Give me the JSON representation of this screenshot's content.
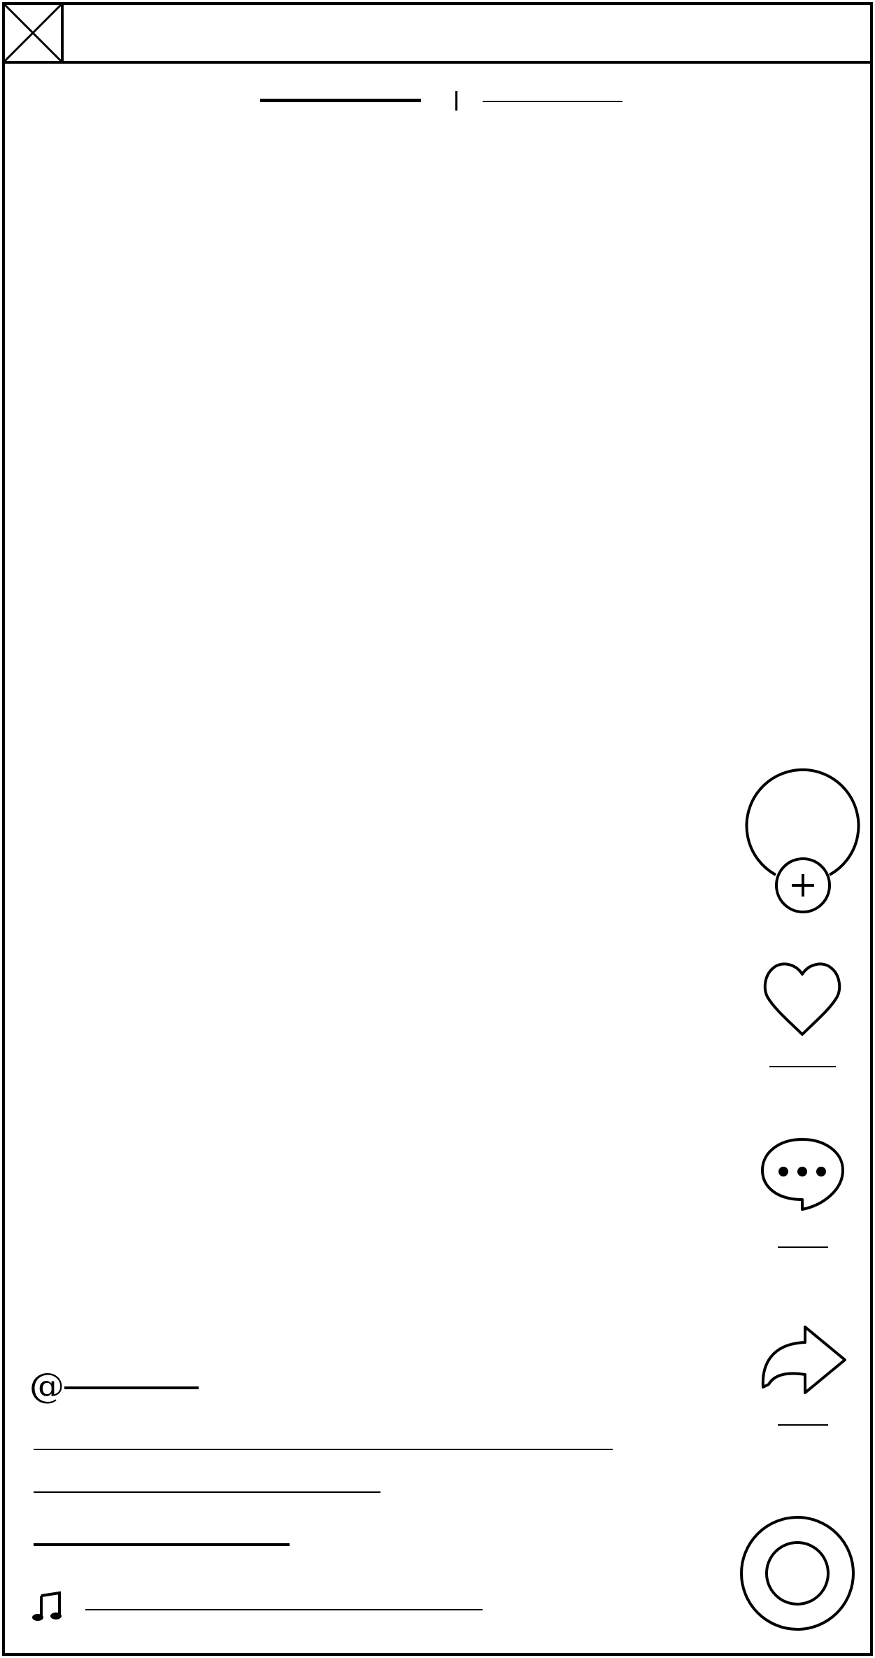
{
  "window": {
    "close_icon": "x-box-icon"
  },
  "top_tabs": {
    "tab_primary_label": "",
    "tab_secondary_label": "",
    "divider": "|"
  },
  "side_actions": {
    "avatar_icon": "avatar-circle-icon",
    "follow_icon": "plus-circle-icon",
    "like_icon": "heart-icon",
    "like_count": "",
    "comment_icon": "speech-bubble-icon",
    "comment_count": "",
    "share_icon": "share-arrow-icon",
    "share_count": "",
    "music_disc_icon": "record-disc-icon"
  },
  "post": {
    "username_prefix": "@",
    "username": "",
    "caption_line_1": "",
    "caption_line_2": "",
    "extra_line": "",
    "music_icon": "music-note-icon",
    "music_title": ""
  },
  "colors": {
    "stroke": "#000000",
    "background": "#ffffff"
  }
}
